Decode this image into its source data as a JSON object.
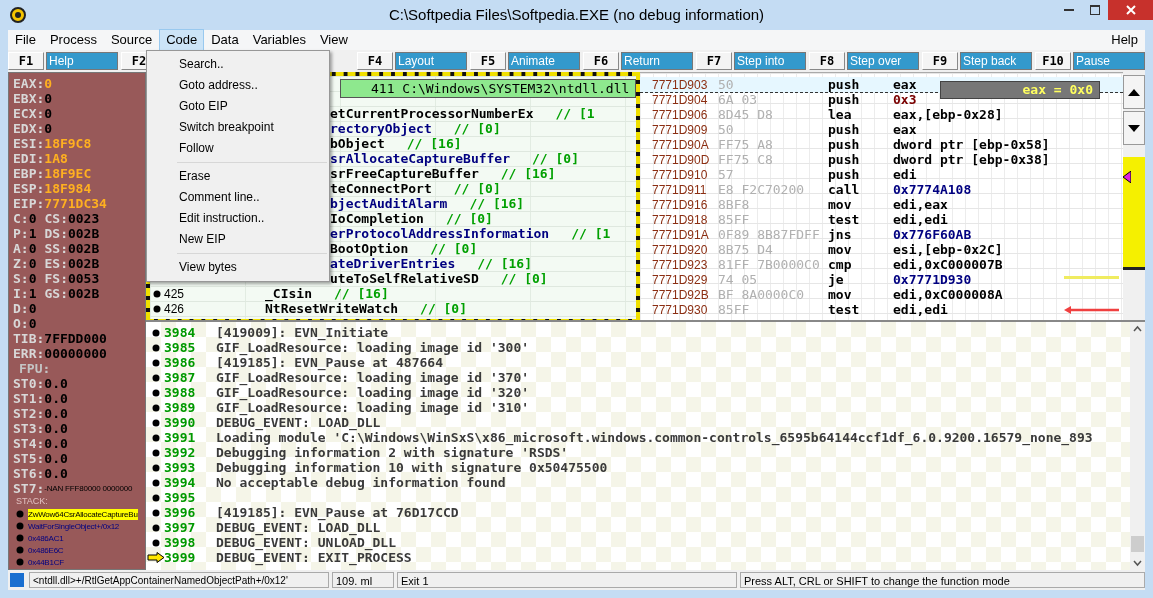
{
  "window": {
    "title": "C:\\Softpedia Files\\Softpedia.EXE (no debug information)"
  },
  "menu": [
    {
      "label": "File",
      "selected": false
    },
    {
      "label": "Process",
      "selected": false
    },
    {
      "label": "Source",
      "selected": false
    },
    {
      "label": "Code",
      "selected": true
    },
    {
      "label": "Data",
      "selected": false
    },
    {
      "label": "Variables",
      "selected": false
    },
    {
      "label": "View",
      "selected": false
    }
  ],
  "menu_right": "Help",
  "code_menu": [
    [
      {
        "label": "Search.."
      },
      {
        "label": "Goto address.."
      },
      {
        "label": "Goto EIP"
      },
      {
        "label": "Switch breakpoint"
      },
      {
        "label": "Follow"
      }
    ],
    [
      {
        "label": "Erase"
      },
      {
        "label": "Comment line.."
      },
      {
        "label": "Edit instruction.."
      },
      {
        "label": "New EIP"
      }
    ],
    [
      {
        "label": "View bytes"
      }
    ]
  ],
  "fkeys_left": [
    {
      "key": "F1",
      "label": "Help"
    },
    {
      "key": "F2"
    }
  ],
  "fkeys": [
    {
      "key": "F4",
      "label": "Layout"
    },
    {
      "key": "F5",
      "label": "Animate"
    },
    {
      "key": "F6",
      "label": "Return"
    },
    {
      "key": "F7",
      "label": "Step into"
    },
    {
      "key": "F8",
      "label": "Step over"
    },
    {
      "key": "F9",
      "label": "Step back"
    },
    {
      "key": "F10",
      "label": "Pause"
    }
  ],
  "registers": [
    [
      {
        "name": "EAX:",
        "value": "0",
        "changed": true
      }
    ],
    [
      {
        "name": "EBX:",
        "value": "0",
        "changed": false
      }
    ],
    [
      {
        "name": "ECX:",
        "value": "0",
        "changed": false
      }
    ],
    [
      {
        "name": "EDX:",
        "value": "0",
        "changed": false
      }
    ],
    [
      {
        "name": "ESI:",
        "value": "18F9C8",
        "changed": true
      }
    ],
    [
      {
        "name": "EDI:",
        "value": "1A8",
        "changed": true
      }
    ],
    [
      {
        "name": "EBP:",
        "value": "18F9EC",
        "changed": true
      }
    ],
    [
      {
        "name": "ESP:",
        "value": "18F984",
        "changed": true
      }
    ],
    [
      {
        "name": "EIP:",
        "value": "7771DC34",
        "changed": true
      }
    ],
    [
      {
        "name": "C:",
        "value": "0",
        "changed": false
      },
      {
        "name": "CS:",
        "value": "0023",
        "changed": false
      }
    ],
    [
      {
        "name": "P:",
        "value": "1",
        "changed": false
      },
      {
        "name": "DS:",
        "value": "002B",
        "changed": false
      }
    ],
    [
      {
        "name": "A:",
        "value": "0",
        "changed": false
      },
      {
        "name": "SS:",
        "value": "002B",
        "changed": false
      }
    ],
    [
      {
        "name": "Z:",
        "value": "0",
        "changed": false
      },
      {
        "name": "ES:",
        "value": "002B",
        "changed": false
      }
    ],
    [
      {
        "name": "S:",
        "value": "0",
        "changed": false
      },
      {
        "name": "FS:",
        "value": "0053",
        "changed": false
      }
    ],
    [
      {
        "name": "I:",
        "value": "1",
        "changed": false
      },
      {
        "name": "GS:",
        "value": "002B",
        "changed": false
      }
    ],
    [
      {
        "name": "D:",
        "value": "0",
        "changed": false
      }
    ],
    [
      {
        "name": "O:",
        "value": "0",
        "changed": false
      }
    ],
    [
      {
        "name": "TIB:",
        "value": "7FFDD000",
        "changed": false
      }
    ],
    [
      {
        "name": "ERR:",
        "value": "00000000",
        "changed": false
      }
    ]
  ],
  "fpu": {
    "label": "FPU:",
    "registers": [
      {
        "name": "ST0:",
        "value": "0.0",
        "kind": "number"
      },
      {
        "name": "ST1:",
        "value": "0.0",
        "kind": "number"
      },
      {
        "name": "ST2:",
        "value": "0.0",
        "kind": "number"
      },
      {
        "name": "ST3:",
        "value": "0.0",
        "kind": "number"
      },
      {
        "name": "ST4:",
        "value": "0.0",
        "kind": "number"
      },
      {
        "name": "ST5:",
        "value": "0.0",
        "kind": "number"
      },
      {
        "name": "ST6:",
        "value": "0.0",
        "kind": "number"
      },
      {
        "name": "ST7:",
        "value": "-NAN FFF80000 0000000",
        "kind": "note"
      }
    ]
  },
  "stack": {
    "label": "STACK:",
    "entries": [
      {
        "text": "ZwWow64CsrAllocateCaptureBu",
        "selected": true
      },
      {
        "text": "WaitForSingleObject+/0x12",
        "selected": false
      },
      {
        "text": "0x486AC1",
        "selected": false
      },
      {
        "text": "0x486E6C",
        "selected": false
      },
      {
        "text": "0x44B1CF",
        "selected": false
      }
    ]
  },
  "code": {
    "tooltip": "411  C:\\Windows\\SYSTEM32\\ntdll.dll",
    "lines": [
      {
        "name": "etCurrentProcessorNumberEx",
        "comment": "// [1",
        "color": "#000000"
      },
      {
        "name": "rectoryObject",
        "comment": "// [0]",
        "color": "#000080"
      },
      {
        "name": "bObject",
        "comment": "// [16]",
        "color": "#000000"
      },
      {
        "name": "srAllocateCaptureBuffer",
        "comment": "// [0]",
        "color": "#000080"
      },
      {
        "name": "srFreeCaptureBuffer",
        "comment": "// [16]",
        "color": "#000000"
      },
      {
        "name": "teConnectPort",
        "comment": "// [0]",
        "color": "#000000"
      },
      {
        "name": "bjectAuditAlarm",
        "comment": "// [16]",
        "color": "#000080"
      },
      {
        "name": "IoCompletion",
        "comment": "// [0]",
        "color": "#000000"
      },
      {
        "name": "erProtocolAddressInformation",
        "comment": "// [1",
        "color": "#000080"
      },
      {
        "name": "BootOption",
        "comment": "// [0]",
        "color": "#000000"
      },
      {
        "name": "ateDriverEntries",
        "comment": "// [16]",
        "color": "#000080"
      },
      {
        "name": "uteToSelfRelativeSD",
        "comment": "// [0]",
        "color": "#000000"
      },
      {
        "number": "425",
        "name": "_CIsin",
        "comment": "// [16]",
        "color": "#000000"
      },
      {
        "number": "426",
        "name": "NtResetWriteWatch",
        "comment": "// [0]",
        "color": "#000000"
      }
    ]
  },
  "disassembly": {
    "tooltip": "eax = 0x0",
    "rows": [
      {
        "address": "7771D903",
        "bytes": "50",
        "mnemonic": "push",
        "operand": "eax",
        "kind": "plain",
        "current": true,
        "jump_source": false,
        "jump_target": false
      },
      {
        "address": "7771D904",
        "bytes": "6A 03",
        "mnemonic": "push",
        "operand": "0x3",
        "kind": "immediate",
        "current": false,
        "jump_source": false,
        "jump_target": false
      },
      {
        "address": "7771D906",
        "bytes": "8D45 D8",
        "mnemonic": "lea",
        "operand": "eax,[ebp-0x28]",
        "kind": "plain",
        "current": false,
        "jump_source": false,
        "jump_target": false
      },
      {
        "address": "7771D909",
        "bytes": "50",
        "mnemonic": "push",
        "operand": "eax",
        "kind": "plain",
        "current": false,
        "jump_source": false,
        "jump_target": false
      },
      {
        "address": "7771D90A",
        "bytes": "FF75 A8",
        "mnemonic": "push",
        "operand": "dword ptr [ebp-0x58]",
        "kind": "plain",
        "current": false,
        "jump_source": false,
        "jump_target": false
      },
      {
        "address": "7771D90D",
        "bytes": "FF75 C8",
        "mnemonic": "push",
        "operand": "dword ptr [ebp-0x38]",
        "kind": "plain",
        "current": false,
        "jump_source": false,
        "jump_target": false
      },
      {
        "address": "7771D910",
        "bytes": "57",
        "mnemonic": "push",
        "operand": "edi",
        "kind": "plain",
        "current": false,
        "jump_source": false,
        "jump_target": false
      },
      {
        "address": "7771D911",
        "bytes": "E8 F2C70200",
        "mnemonic": "call",
        "operand": "0x7774A108",
        "kind": "target",
        "current": false,
        "jump_source": false,
        "jump_target": false
      },
      {
        "address": "7771D916",
        "bytes": "8BF8",
        "mnemonic": "mov",
        "operand": "edi,eax",
        "kind": "plain",
        "current": false,
        "jump_source": false,
        "jump_target": false
      },
      {
        "address": "7771D918",
        "bytes": "85FF",
        "mnemonic": "test",
        "operand": "edi,edi",
        "kind": "plain",
        "current": false,
        "jump_source": false,
        "jump_target": false
      },
      {
        "address": "7771D91A",
        "bytes": "0F89 8B87FDFF",
        "mnemonic": "jns",
        "operand": "0x776F60AB",
        "kind": "target",
        "current": false,
        "jump_source": false,
        "jump_target": false
      },
      {
        "address": "7771D920",
        "bytes": "8B75 D4",
        "mnemonic": "mov",
        "operand": "esi,[ebp-0x2C]",
        "kind": "plain",
        "current": false,
        "jump_source": false,
        "jump_target": false
      },
      {
        "address": "7771D923",
        "bytes": "81FF 7B0000C0",
        "mnemonic": "cmp",
        "operand": "edi,0xC000007B",
        "kind": "plain",
        "current": false,
        "jump_source": false,
        "jump_target": false
      },
      {
        "address": "7771D929",
        "bytes": "74 05",
        "mnemonic": "je",
        "operand": "0x7771D930",
        "kind": "target",
        "current": false,
        "jump_source": true,
        "jump_target": false
      },
      {
        "address": "7771D92B",
        "bytes": "BF 8A0000C0",
        "mnemonic": "mov",
        "operand": "edi,0xC000008A",
        "kind": "plain",
        "current": false,
        "jump_source": false,
        "jump_target": false
      },
      {
        "address": "7771D930",
        "bytes": "85FF",
        "mnemonic": "test",
        "operand": "edi,edi",
        "kind": "plain",
        "current": false,
        "jump_source": false,
        "jump_target": true
      }
    ]
  },
  "console": [
    {
      "number": "3984",
      "text": "[419009]: EVN_Initiate",
      "current": false
    },
    {
      "number": "3985",
      "text": "GIF_LoadResource: loading image id '300'",
      "current": false
    },
    {
      "number": "3986",
      "text": "[419185]: EVN_Pause at 487664",
      "current": false
    },
    {
      "number": "3987",
      "text": "GIF_LoadResource: loading image id '370'",
      "current": false
    },
    {
      "number": "3988",
      "text": "GIF_LoadResource: loading image id '320'",
      "current": false
    },
    {
      "number": "3989",
      "text": "GIF_LoadResource: loading image id '310'",
      "current": false
    },
    {
      "number": "3990",
      "text": "DEBUG_EVENT: LOAD_DLL",
      "current": false
    },
    {
      "number": "3991",
      "text": "Loading module 'C:\\Windows\\WinSxS\\x86_microsoft.windows.common-controls_6595b64144ccf1df_6.0.9200.16579_none_893",
      "current": false
    },
    {
      "number": "3992",
      "text": "Debugging information 2 with signature 'RSDS'",
      "current": false
    },
    {
      "number": "3993",
      "text": "Debugging information 10 with signature 0x50475500",
      "current": false
    },
    {
      "number": "3994",
      "text": "No acceptable debug information found",
      "current": false
    },
    {
      "number": "3995",
      "current": false
    },
    {
      "number": "3996",
      "text": "[419185]: EVN_Pause at 76D17CCD",
      "current": false
    },
    {
      "number": "3997",
      "text": "DEBUG_EVENT: LOAD_DLL",
      "current": false
    },
    {
      "number": "3998",
      "text": "DEBUG_EVENT: UNLOAD_DLL",
      "current": false
    },
    {
      "number": "3999",
      "text": "DEBUG_EVENT: EXIT_PROCESS",
      "current": true
    }
  ],
  "status_bar": {
    "location": "<ntdll.dll>+/RtlGetAppContainerNamedObjectPath+/0x12'",
    "line": "109. ml",
    "exit": "Exit 1",
    "hint": "Press ALT, CRL or SHIFT to change the function mode"
  }
}
